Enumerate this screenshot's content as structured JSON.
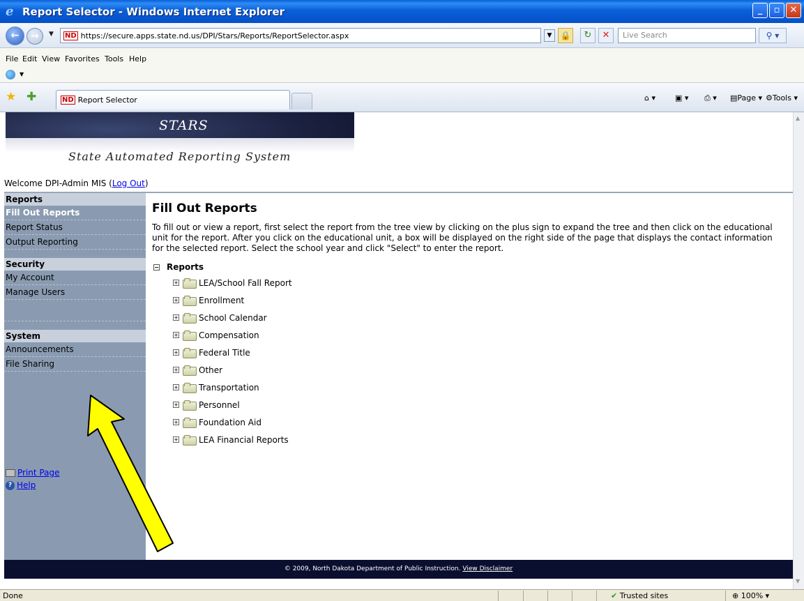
{
  "window": {
    "title": "Report Selector - Windows Internet Explorer"
  },
  "address": {
    "url": "https://secure.apps.state.nd.us/DPI/Stars/Reports/ReportSelector.aspx",
    "search_placeholder": "Live Search"
  },
  "menu": {
    "items": [
      "File",
      "Edit",
      "View",
      "Favorites",
      "Tools",
      "Help"
    ]
  },
  "tab": {
    "label": "Report Selector",
    "favicon_text": "ND"
  },
  "commands": {
    "page_label": "Page",
    "tools_label": "Tools"
  },
  "banner": {
    "title": "STARS",
    "subtitle": "State Automated Reporting System"
  },
  "welcome": {
    "prefix": "Welcome DPI-Admin MIS (",
    "logout": "Log Out",
    "suffix": ")"
  },
  "sidebar": {
    "sections": [
      {
        "title": "Reports",
        "items": [
          "Fill Out Reports",
          "Report Status",
          "Output Reporting"
        ]
      },
      {
        "title": "Security",
        "items": [
          "My Account",
          "Manage Users"
        ]
      },
      {
        "title": "System",
        "items": [
          "Announcements",
          "File Sharing"
        ]
      }
    ],
    "print_label": "Print Page",
    "help_label": "Help"
  },
  "content": {
    "heading": "Fill Out Reports",
    "instructions": "To fill out or view a report, first select the report from the tree view by clicking on the plus sign to expand the tree and then click on the educational unit for the report. After you click on the educational unit, a box will be displayed on the right side of the page that displays the contact information for the selected report. Select the school year and click \"Select\" to enter the report.",
    "tree_root": "Reports",
    "tree_items": [
      "LEA/School Fall Report",
      "Enrollment",
      "School Calendar",
      "Compensation",
      "Federal Title",
      "Other",
      "Transportation",
      "Personnel",
      "Foundation Aid",
      "LEA Financial Reports"
    ]
  },
  "footer": {
    "text": "© 2009, North Dakota Department of Public Instruction.",
    "link": "View Disclaimer"
  },
  "status": {
    "text": "Done",
    "zone": "Trusted sites",
    "zoom": "100%"
  },
  "colors": {
    "sidebar_bg": "#8a9bb1",
    "footer_bg": "#0b0f2f",
    "annotation_arrow": "#ffff00"
  }
}
